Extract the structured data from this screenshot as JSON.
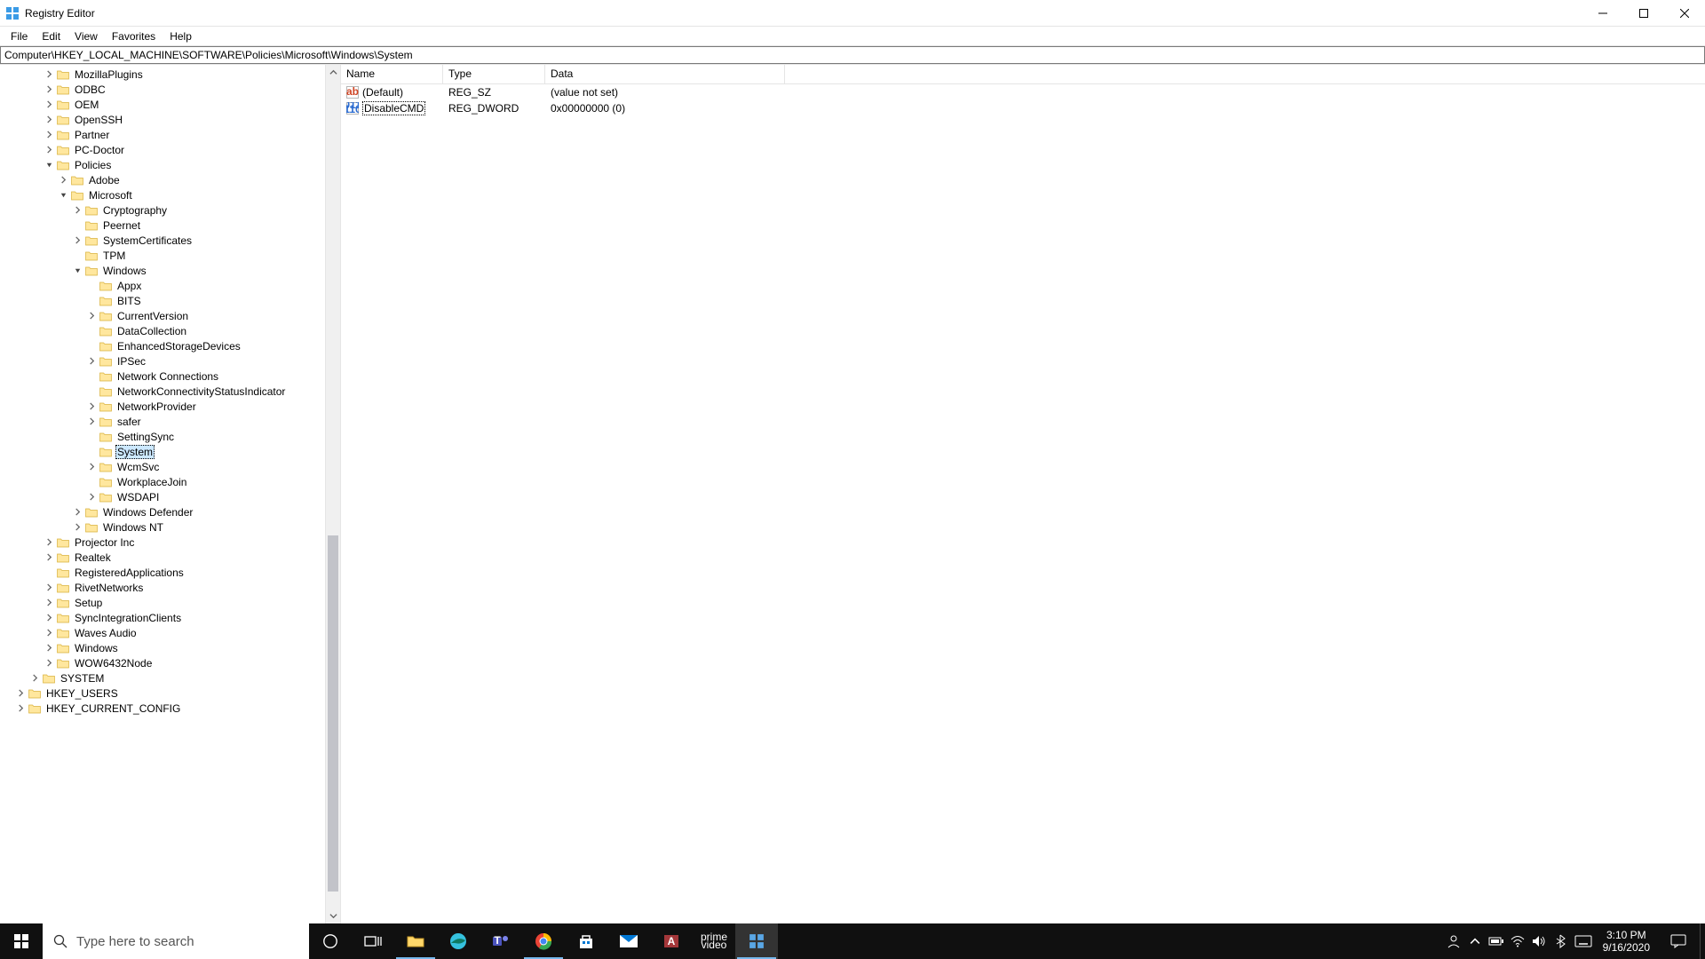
{
  "window": {
    "title": "Registry Editor"
  },
  "menu": {
    "file": "File",
    "edit": "Edit",
    "view": "View",
    "favorites": "Favorites",
    "help": "Help"
  },
  "address": "Computer\\HKEY_LOCAL_MACHINE\\SOFTWARE\\Policies\\Microsoft\\Windows\\System",
  "tree": [
    {
      "depth": 3,
      "expander": "closed",
      "label": "MozillaPlugins"
    },
    {
      "depth": 3,
      "expander": "closed",
      "label": "ODBC"
    },
    {
      "depth": 3,
      "expander": "closed",
      "label": "OEM"
    },
    {
      "depth": 3,
      "expander": "closed",
      "label": "OpenSSH"
    },
    {
      "depth": 3,
      "expander": "closed",
      "label": "Partner"
    },
    {
      "depth": 3,
      "expander": "closed",
      "label": "PC-Doctor"
    },
    {
      "depth": 3,
      "expander": "open",
      "label": "Policies"
    },
    {
      "depth": 4,
      "expander": "closed",
      "label": "Adobe"
    },
    {
      "depth": 4,
      "expander": "open",
      "label": "Microsoft"
    },
    {
      "depth": 5,
      "expander": "closed",
      "label": "Cryptography"
    },
    {
      "depth": 5,
      "expander": "none",
      "label": "Peernet"
    },
    {
      "depth": 5,
      "expander": "closed",
      "label": "SystemCertificates"
    },
    {
      "depth": 5,
      "expander": "none",
      "label": "TPM"
    },
    {
      "depth": 5,
      "expander": "open",
      "label": "Windows"
    },
    {
      "depth": 6,
      "expander": "none",
      "label": "Appx"
    },
    {
      "depth": 6,
      "expander": "none",
      "label": "BITS"
    },
    {
      "depth": 6,
      "expander": "closed",
      "label": "CurrentVersion"
    },
    {
      "depth": 6,
      "expander": "none",
      "label": "DataCollection"
    },
    {
      "depth": 6,
      "expander": "none",
      "label": "EnhancedStorageDevices"
    },
    {
      "depth": 6,
      "expander": "closed",
      "label": "IPSec"
    },
    {
      "depth": 6,
      "expander": "none",
      "label": "Network Connections"
    },
    {
      "depth": 6,
      "expander": "none",
      "label": "NetworkConnectivityStatusIndicator"
    },
    {
      "depth": 6,
      "expander": "closed",
      "label": "NetworkProvider"
    },
    {
      "depth": 6,
      "expander": "closed",
      "label": "safer"
    },
    {
      "depth": 6,
      "expander": "none",
      "label": "SettingSync"
    },
    {
      "depth": 6,
      "expander": "none",
      "label": "System",
      "selected": true
    },
    {
      "depth": 6,
      "expander": "closed",
      "label": "WcmSvc"
    },
    {
      "depth": 6,
      "expander": "none",
      "label": "WorkplaceJoin"
    },
    {
      "depth": 6,
      "expander": "closed",
      "label": "WSDAPI"
    },
    {
      "depth": 5,
      "expander": "closed",
      "label": "Windows Defender"
    },
    {
      "depth": 5,
      "expander": "closed",
      "label": "Windows NT"
    },
    {
      "depth": 3,
      "expander": "closed",
      "label": "Projector Inc"
    },
    {
      "depth": 3,
      "expander": "closed",
      "label": "Realtek"
    },
    {
      "depth": 3,
      "expander": "none",
      "label": "RegisteredApplications"
    },
    {
      "depth": 3,
      "expander": "closed",
      "label": "RivetNetworks"
    },
    {
      "depth": 3,
      "expander": "closed",
      "label": "Setup"
    },
    {
      "depth": 3,
      "expander": "closed",
      "label": "SyncIntegrationClients"
    },
    {
      "depth": 3,
      "expander": "closed",
      "label": "Waves Audio"
    },
    {
      "depth": 3,
      "expander": "closed",
      "label": "Windows"
    },
    {
      "depth": 3,
      "expander": "closed",
      "label": "WOW6432Node"
    },
    {
      "depth": 2,
      "expander": "closed",
      "label": "SYSTEM"
    },
    {
      "depth": 1,
      "expander": "closed",
      "label": "HKEY_USERS"
    },
    {
      "depth": 1,
      "expander": "closed",
      "label": "HKEY_CURRENT_CONFIG"
    }
  ],
  "columns": {
    "name": "Name",
    "type": "Type",
    "data": "Data"
  },
  "values": [
    {
      "icon": "sz",
      "name": "(Default)",
      "type": "REG_SZ",
      "data": "(value not set)",
      "highlight": false
    },
    {
      "icon": "dword",
      "name": "DisableCMD",
      "type": "REG_DWORD",
      "data": "0x00000000 (0)",
      "highlight": true
    }
  ],
  "taskbar": {
    "search_placeholder": "Type here to search",
    "prime_line1": "prime",
    "prime_line2": "video",
    "time": "3:10 PM",
    "date": "9/16/2020"
  }
}
